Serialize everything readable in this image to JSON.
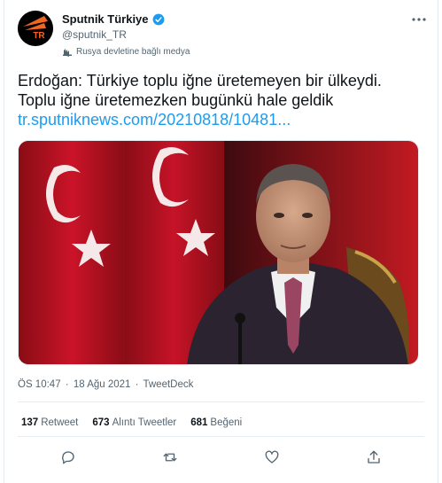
{
  "author": {
    "name": "Sputnik Türkiye",
    "handle": "@sputnik_TR",
    "label": "Rusya devletine bağlı medya",
    "avatar_text": "TR"
  },
  "tweet": {
    "line1": "Erdoğan: Türkiye toplu iğne üretemeyen bir ülkeydi.",
    "line2": "Toplu iğne üretemezken bugünkü hale geldik",
    "link": "tr.sputniknews.com/20210818/10481..."
  },
  "meta": {
    "time": "ÖS 10:47",
    "sep1": "·",
    "date": "18 Ağu 2021",
    "sep2": "·",
    "source": "TweetDeck"
  },
  "stats": [
    {
      "count": "137",
      "label": "Retweet"
    },
    {
      "count": "673",
      "label": "Alıntı Tweetler"
    },
    {
      "count": "681",
      "label": "Beğeni"
    }
  ],
  "icons": {
    "verified": "verified-badge-icon",
    "label": "state-media-icon",
    "more": "more-dots-icon",
    "reply": "reply-icon",
    "retweet": "retweet-icon",
    "like": "heart-icon",
    "share": "share-icon"
  },
  "colors": {
    "accent": "#1d9bf0",
    "text": "#0f1419",
    "muted": "#536471",
    "avatar_orange": "#f26522",
    "flag_red": "#c8102e"
  }
}
